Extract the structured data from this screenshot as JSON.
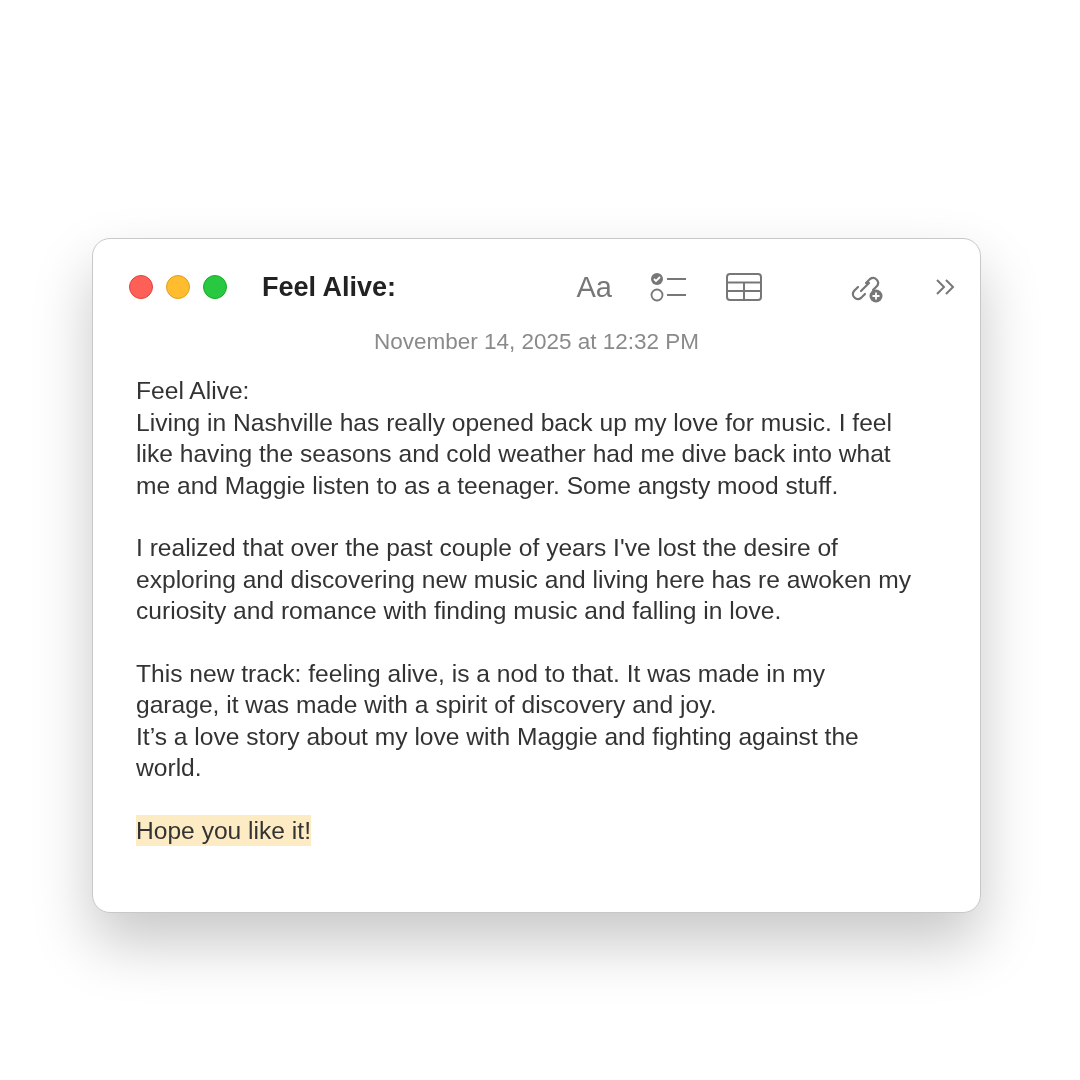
{
  "window": {
    "title": "Feel Alive:",
    "controls": [
      {
        "kind": "close",
        "color": "#fe5f57"
      },
      {
        "kind": "minimize",
        "color": "#febc2e"
      },
      {
        "kind": "zoom",
        "color": "#28c840"
      }
    ]
  },
  "toolbar": [
    {
      "kind": "format"
    },
    {
      "kind": "checklist"
    },
    {
      "kind": "table"
    },
    {
      "kind": "collaborate"
    },
    {
      "kind": "more"
    }
  ],
  "toolbar_format_label": "Aa",
  "note": {
    "date": "November 14, 2025 at 12:32 PM",
    "paragraphs": [
      {
        "highlighted": false,
        "lines": [
          "Feel Alive:",
          "Living in Nashville has really opened back up my love for music. I feel",
          "like having the seasons and cold weather had me dive back into what",
          "me and Maggie listen to as a teenager. Some angsty mood stuff."
        ]
      },
      {
        "highlighted": false,
        "lines": [
          "I realized that over the past couple of years I've lost the desire of",
          "exploring and discovering new music and living here has re awoken my",
          "curiosity and romance with finding music and falling in love."
        ]
      },
      {
        "highlighted": false,
        "lines": [
          "This new track: feeling alive, is a nod to that. It was made in my",
          "garage, it was made with a spirit of discovery and joy.",
          "It’s a love story about my love with Maggie and fighting against the",
          "world."
        ]
      },
      {
        "highlighted": true,
        "lines": [
          "Hope you like it!"
        ]
      }
    ]
  }
}
